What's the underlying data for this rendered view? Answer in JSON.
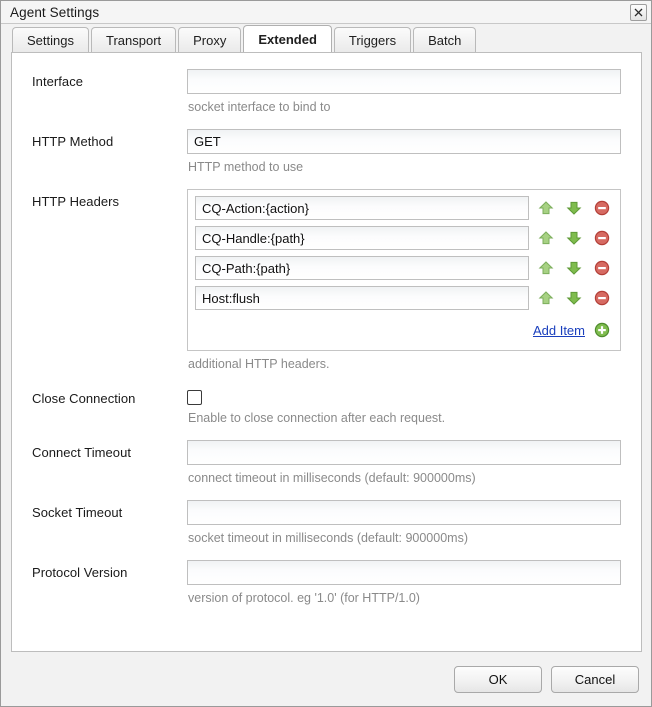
{
  "window": {
    "title": "Agent Settings",
    "close_label": "×"
  },
  "tabs": [
    {
      "label": "Settings",
      "active": false
    },
    {
      "label": "Transport",
      "active": false
    },
    {
      "label": "Proxy",
      "active": false
    },
    {
      "label": "Extended",
      "active": true
    },
    {
      "label": "Triggers",
      "active": false
    },
    {
      "label": "Batch",
      "active": false
    }
  ],
  "form": {
    "interface": {
      "label": "Interface",
      "value": "",
      "hint": "socket interface to bind to"
    },
    "http_method": {
      "label": "HTTP Method",
      "value": "GET",
      "hint": "HTTP method to use"
    },
    "http_headers": {
      "label": "HTTP Headers",
      "items": [
        "CQ-Action:{action}",
        "CQ-Handle:{path}",
        "CQ-Path:{path}",
        "Host:flush"
      ],
      "add_item_label": "Add Item",
      "hint": "additional HTTP headers."
    },
    "close_connection": {
      "label": "Close Connection",
      "checked": false,
      "hint": "Enable to close connection after each request."
    },
    "connect_timeout": {
      "label": "Connect Timeout",
      "value": "",
      "hint": "connect timeout in milliseconds (default: 900000ms)"
    },
    "socket_timeout": {
      "label": "Socket Timeout",
      "value": "",
      "hint": "socket timeout in milliseconds (default: 900000ms)"
    },
    "protocol_version": {
      "label": "Protocol Version",
      "value": "",
      "hint": "version of protocol. eg '1.0' (for HTTP/1.0)"
    }
  },
  "footer": {
    "ok_label": "OK",
    "cancel_label": "Cancel"
  },
  "icons": {
    "move_up": "move-up-icon",
    "move_down": "move-down-icon",
    "remove": "remove-icon",
    "add": "add-icon"
  },
  "colors": {
    "link": "#1a3fbd",
    "green_up": "#9ccf7a",
    "green_down": "#76b94a",
    "red_remove": "#d0564e",
    "green_add": "#6fb648",
    "panel_bg": "#ffffff",
    "window_bg": "#f2f2f2"
  }
}
